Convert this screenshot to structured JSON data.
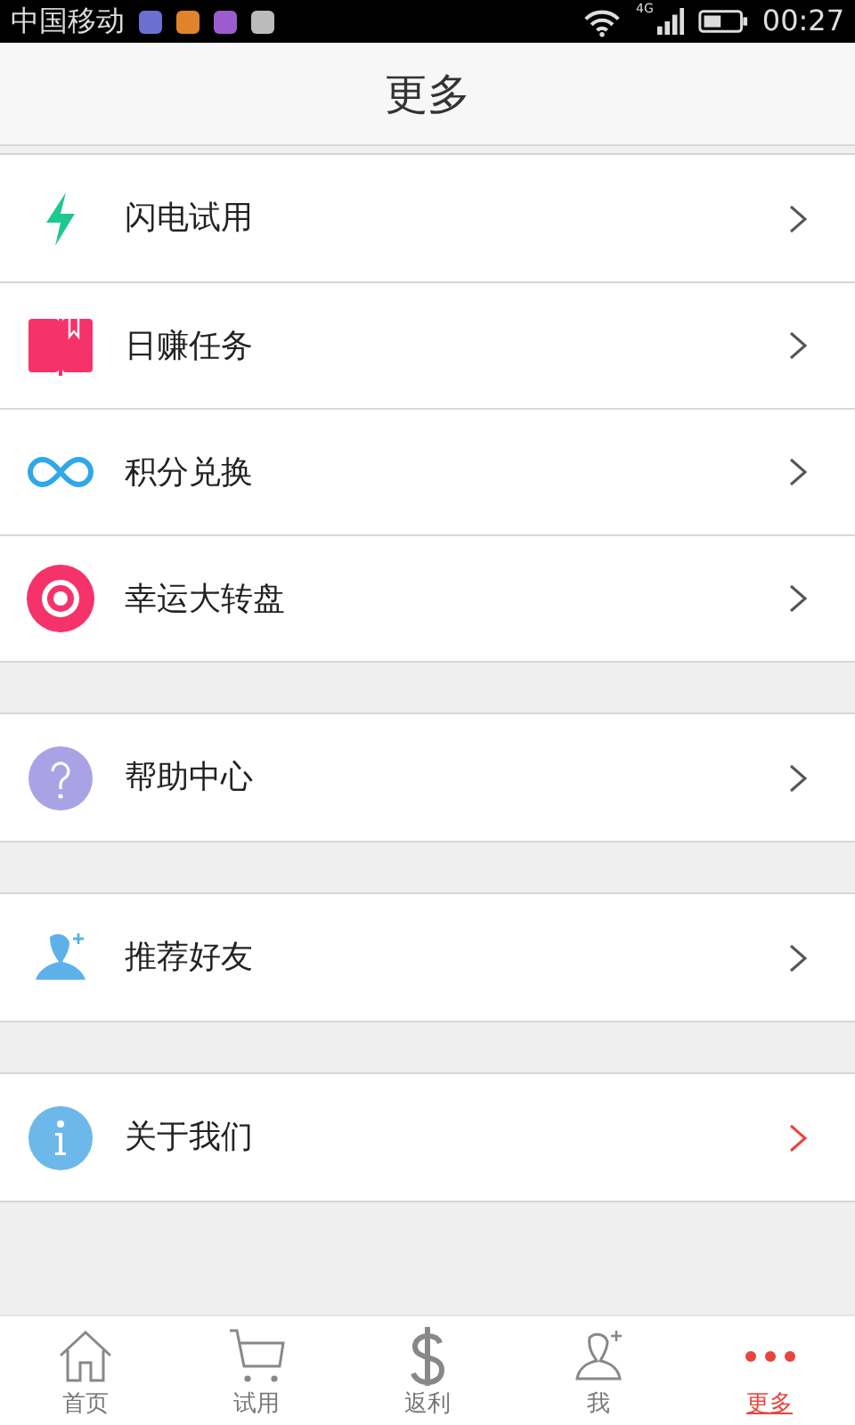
{
  "status_bar": {
    "carrier": "中国移动",
    "network": "4G",
    "time": "00:27"
  },
  "header": {
    "title": "更多"
  },
  "groups": [
    {
      "items": [
        {
          "label": "闪电试用",
          "highlighted": false
        },
        {
          "label": "日赚任务",
          "highlighted": false
        },
        {
          "label": "积分兑换",
          "highlighted": false
        },
        {
          "label": "幸运大转盘",
          "highlighted": false
        }
      ]
    },
    {
      "items": [
        {
          "label": "帮助中心",
          "highlighted": false
        }
      ]
    },
    {
      "items": [
        {
          "label": "推荐好友",
          "highlighted": false
        }
      ]
    },
    {
      "items": [
        {
          "label": "关于我们",
          "highlighted": true
        }
      ]
    }
  ],
  "tab_bar": [
    {
      "label": "首页",
      "selected": false
    },
    {
      "label": "试用",
      "selected": false
    },
    {
      "label": "返利",
      "selected": false
    },
    {
      "label": "我",
      "selected": false
    },
    {
      "label": "更多",
      "selected": true
    }
  ]
}
